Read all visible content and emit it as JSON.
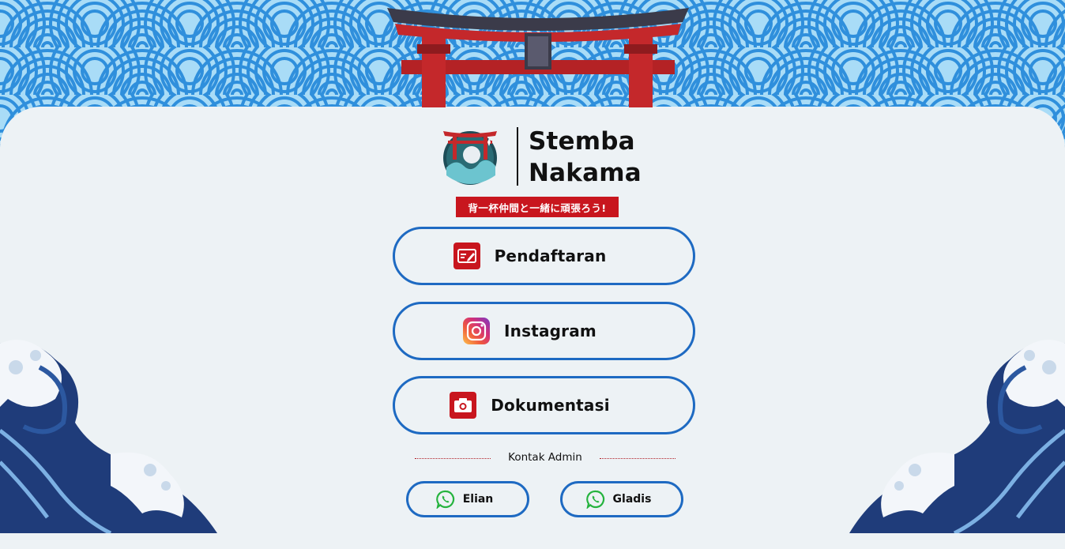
{
  "brand": {
    "line1": "Stemba",
    "line2": "Nakama",
    "tagline": "背一杯仲間と一緒に頑張ろう!"
  },
  "links": [
    {
      "label": "Pendaftaran",
      "icon": "registration-form-icon"
    },
    {
      "label": "Instagram",
      "icon": "instagram-icon"
    },
    {
      "label": "Dokumentasi",
      "icon": "camera-icon"
    }
  ],
  "contact": {
    "heading": "Kontak Admin",
    "admins": [
      {
        "name": "Elian",
        "icon": "whatsapp-icon"
      },
      {
        "name": "Gladis",
        "icon": "whatsapp-icon"
      }
    ]
  },
  "colors": {
    "accent_blue": "#1e6ac2",
    "brand_red": "#c8161e",
    "card_bg": "#edf2f5",
    "sky_blue": "#a9dcf7"
  }
}
